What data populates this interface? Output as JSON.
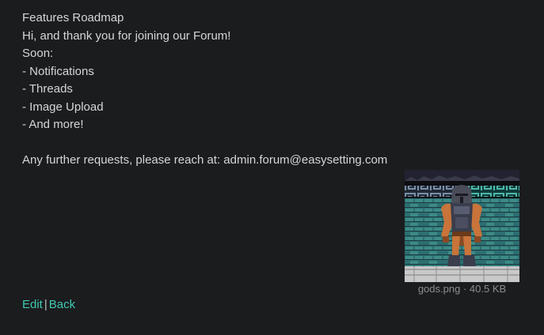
{
  "post": {
    "title": "Features Roadmap",
    "greeting": "Hi, and thank you for joining our Forum!",
    "soon_label": "Soon:",
    "items": [
      "- Notifications",
      "- Threads",
      "- Image Upload",
      "- And more!"
    ],
    "contact": "Any further requests, please reach at: admin.forum@easysetting.com"
  },
  "attachment": {
    "filename": "gods.png",
    "separator": "·",
    "size": "40.5 KB"
  },
  "actions": {
    "edit_label": "Edit",
    "divider": "|",
    "back_label": "Back"
  },
  "colors": {
    "background": "#1b1c1e",
    "text": "#d6d6d6",
    "link": "#3fc9b1",
    "muted": "#8e8e8e"
  }
}
